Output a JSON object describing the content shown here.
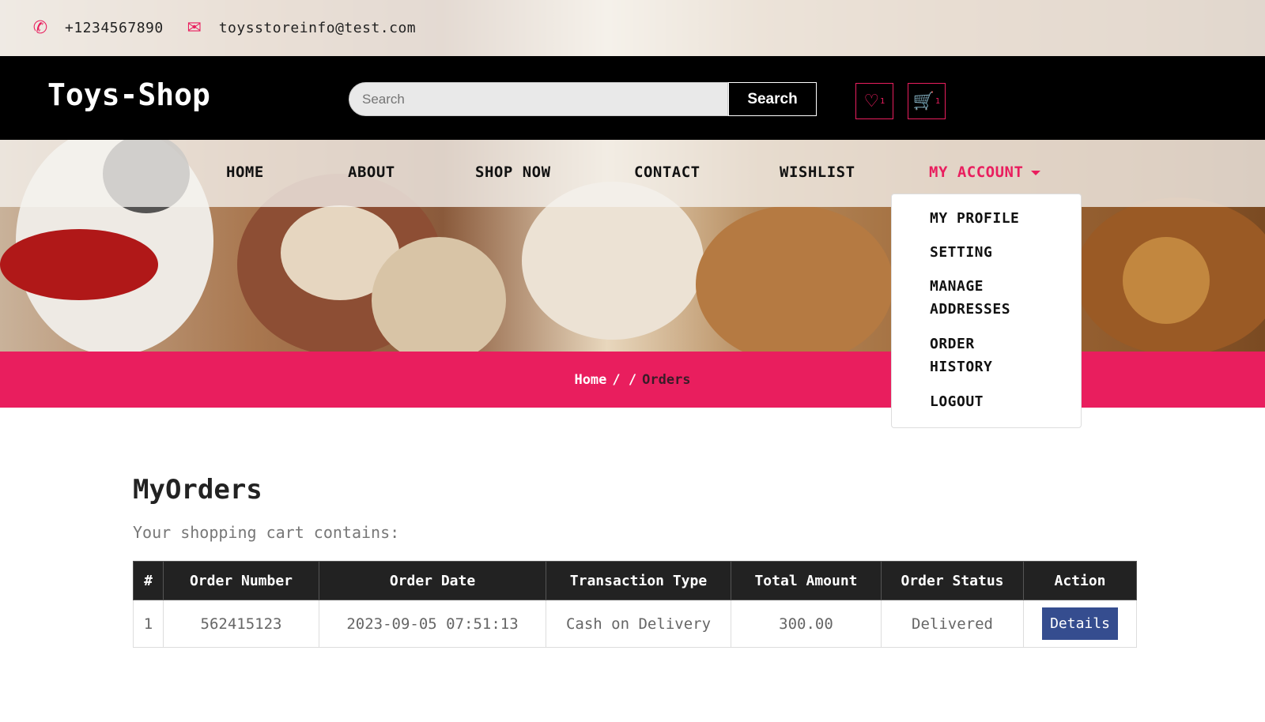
{
  "topbar": {
    "phone_icon": "phone-icon",
    "phone": "+1234567890",
    "email_icon": "envelope-icon",
    "email": "toysstoreinfo@test.com"
  },
  "header": {
    "logo": "Toys-Shop",
    "search_placeholder": "Search",
    "search_button": "Search",
    "wishlist_count": "1",
    "cart_count": "1"
  },
  "nav": {
    "items": [
      "HOME",
      "ABOUT",
      "SHOP NOW",
      "CONTACT",
      "WISHLIST",
      "MY ACCOUNT"
    ]
  },
  "dropdown": {
    "items": [
      "MY PROFILE",
      "SETTING",
      "MANAGE ADDRESSES",
      "ORDER HISTORY",
      "LOGOUT"
    ]
  },
  "breadcrumb": {
    "home": "Home",
    "sep": "/ /",
    "current": "Orders"
  },
  "orders": {
    "title": "MyOrders",
    "subtitle": "Your shopping cart contains:",
    "headers": [
      "#",
      "Order Number",
      "Order Date",
      "Transaction Type",
      "Total Amount",
      "Order Status",
      "Action"
    ],
    "rows": [
      {
        "index": "1",
        "order_number": "562415123",
        "order_date": "2023-09-05 07:51:13",
        "transaction_type": "Cash on Delivery",
        "total_amount": "300.00",
        "status": "Delivered",
        "action": "Details"
      }
    ]
  },
  "colors": {
    "accent": "#e91e5e",
    "header_bg": "#000000",
    "table_header_bg": "#222222",
    "details_button": "#354d8f"
  }
}
